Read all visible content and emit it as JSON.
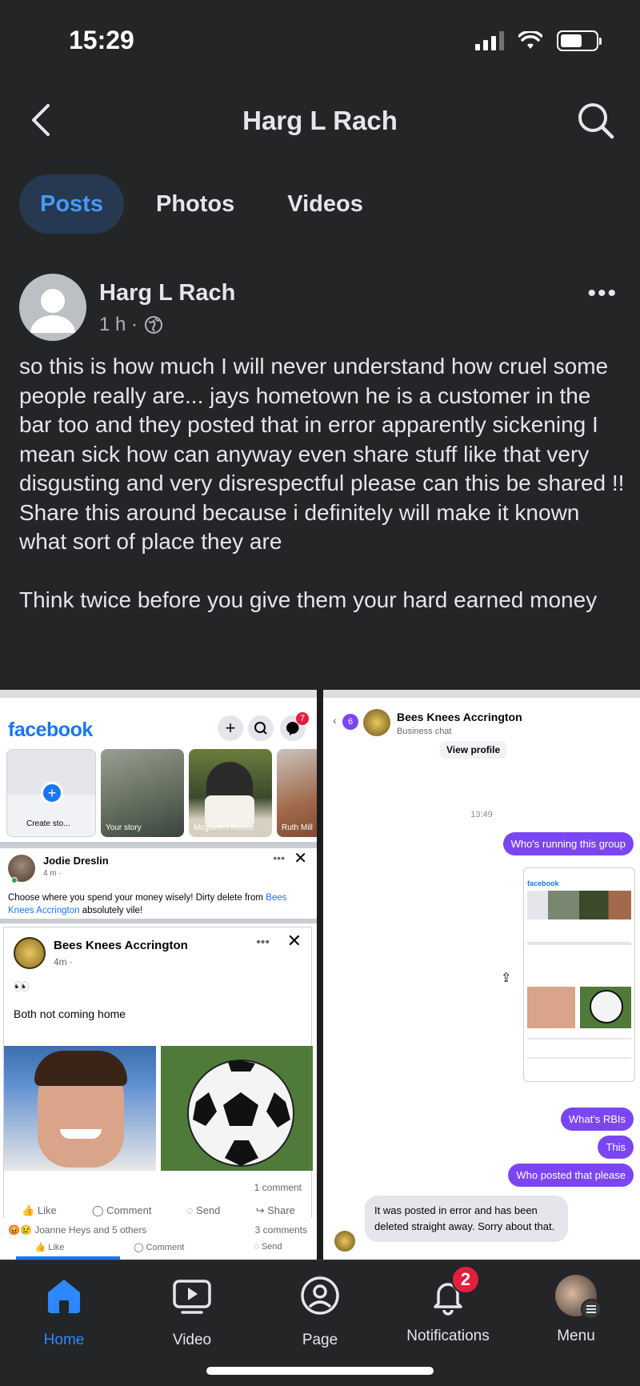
{
  "status": {
    "time": "15:29"
  },
  "header": {
    "title": "Harg L Rach"
  },
  "tabs": [
    {
      "label": "Posts"
    },
    {
      "label": "Photos"
    },
    {
      "label": "Videos"
    }
  ],
  "post": {
    "author": "Harg L Rach",
    "time": "1 h ·",
    "text": "so this is how much I will never understand how cruel some people really are... jays hometown he is a customer in the bar too and they posted that in error apparently sickening I mean sick how can anyway even share stuff like that very disgusting and very disrespectful please can this be shared !! Share this around because i definitely will make it known what sort of place they are\n\nThink twice before you give them your hard earned money"
  },
  "screenshot_left": {
    "logo": "facebook",
    "messenger_badge": "7",
    "stories": [
      "Create sto...",
      "Your story",
      "Mcgovern Reece",
      "Ruth Mill"
    ],
    "share": {
      "author": "Jodie Dreslin",
      "meta": "4 m · ",
      "text": "Choose where you spend your money wisely! Dirty delete from",
      "link": "Bees Knees Accrington",
      "text_end": " absolutely vile!"
    },
    "embedded": {
      "author": "Bees Knees Accrington",
      "meta": "4m ·",
      "emoji": "👀",
      "caption": "Both not coming home",
      "comment_count": "1 comment",
      "actions": [
        "Like",
        "Comment",
        "Send",
        "Share"
      ],
      "reactions": "Joanne Heys and 5 others",
      "comments": "3 comments",
      "bottom_actions": [
        "Like",
        "Comment",
        "Send"
      ]
    }
  },
  "screenshot_right": {
    "back_count": "6",
    "name": "Bees Knees Accrington",
    "sub": "Business chat",
    "view_profile": "View profile",
    "timestamp": "13:49",
    "msg1": "Who's running this group",
    "msg2": "What's RBIs",
    "msg3": "This",
    "msg4": "Who posted that please",
    "reply": "It was posted in error and has been deleted straight away. Sorry about that.",
    "mini_logo": "facebook"
  },
  "bottomnav": {
    "home": "Home",
    "video": "Video",
    "page": "Page",
    "notifications": "Notifications",
    "menu": "Menu",
    "notif_count": "2"
  },
  "colors": {
    "accent": "#2d88ff",
    "bg": "#242527",
    "purple": "#7b46f1",
    "badge": "#e41e3f"
  }
}
